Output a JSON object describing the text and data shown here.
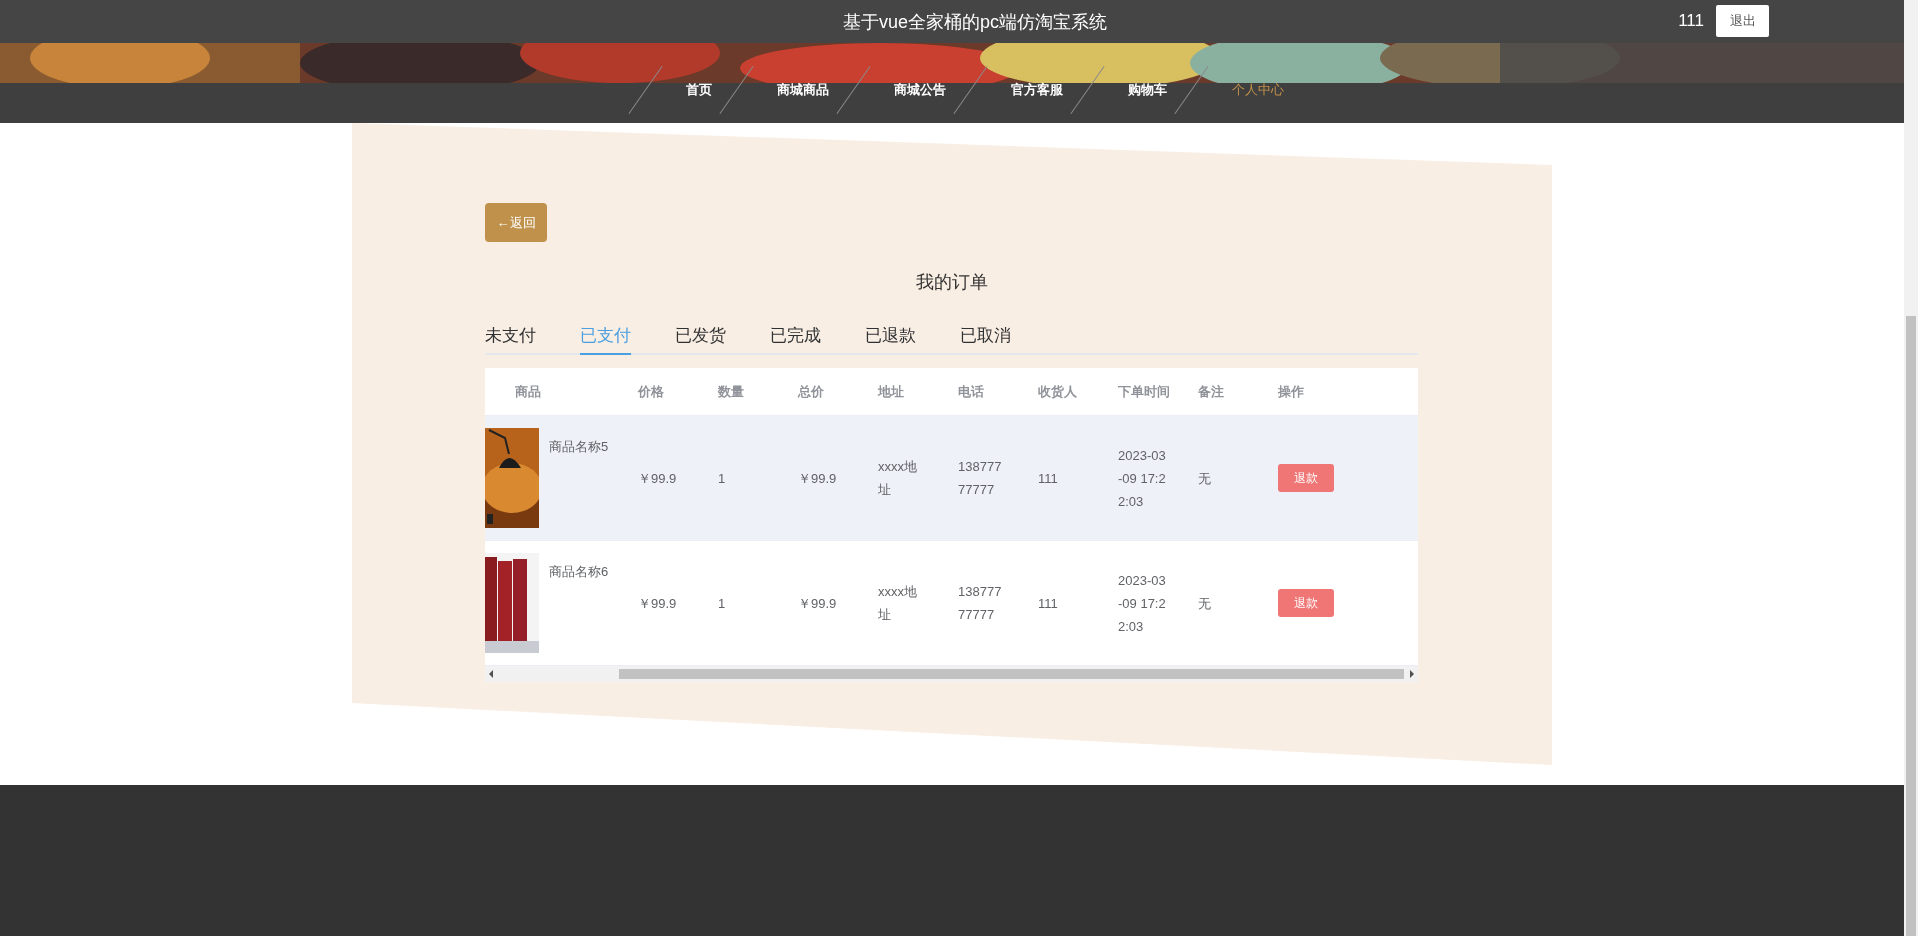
{
  "header": {
    "title": "基于vue全家桶的pc端仿淘宝系统",
    "user": "111",
    "logout": "退出"
  },
  "nav": [
    {
      "label": "首页",
      "selected": false
    },
    {
      "label": "商城商品",
      "selected": false
    },
    {
      "label": "商城公告",
      "selected": false
    },
    {
      "label": "官方客服",
      "selected": false
    },
    {
      "label": "购物车",
      "selected": false
    },
    {
      "label": "个人中心",
      "selected": true
    }
  ],
  "back_button": "←返回",
  "page_title": "我的订单",
  "tabs": [
    {
      "label": "未支付",
      "selected": false
    },
    {
      "label": "已支付",
      "selected": true
    },
    {
      "label": "已发货",
      "selected": false
    },
    {
      "label": "已完成",
      "selected": false
    },
    {
      "label": "已退款",
      "selected": false
    },
    {
      "label": "已取消",
      "selected": false
    }
  ],
  "table": {
    "columns": [
      "商品",
      "价格",
      "数量",
      "总价",
      "地址",
      "电话",
      "收货人",
      "下单时间",
      "备注",
      "操作"
    ],
    "rows": [
      {
        "product": "商品名称5",
        "price": "￥99.9",
        "quantity": "1",
        "total": "￥99.9",
        "address": "xxxx地址",
        "phone": "13877777777",
        "receiver": "111",
        "time": "2023-03-09 17:22:03",
        "note": "无",
        "action": "退款",
        "highlighted": true
      },
      {
        "product": "商品名称6",
        "price": "￥99.9",
        "quantity": "1",
        "total": "￥99.9",
        "address": "xxxx地址",
        "phone": "13877777777",
        "receiver": "111",
        "time": "2023-03-09 17:22:03",
        "note": "无",
        "action": "退款",
        "highlighted": false
      }
    ]
  }
}
